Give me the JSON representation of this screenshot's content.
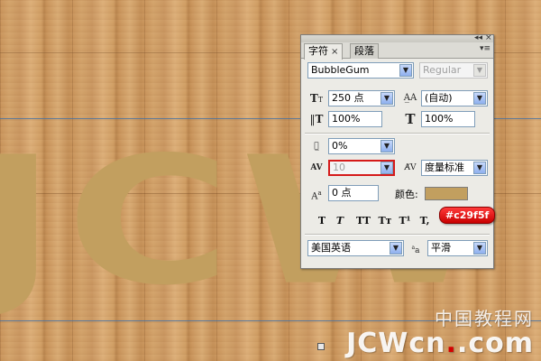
{
  "canvas": {
    "text": "JCW",
    "text_color": "#c29f5f",
    "guide_color": "#3f6fa8"
  },
  "watermark": {
    "cn": "中国教程网",
    "en_prefix": "JCW",
    "en_accent": "c",
    "en_dot": "n",
    "en_suffix": ".com"
  },
  "panel": {
    "tabs": [
      {
        "label": "字符",
        "active": true,
        "close": "×"
      },
      {
        "label": "段落",
        "active": false
      }
    ],
    "font_family": "BubbleGum",
    "font_style": "Regular",
    "font_size": "250 点",
    "leading": "(自动)",
    "vertical_scale": "100%",
    "horizontal_scale": "100%",
    "tsume": "0%",
    "kerning": "10",
    "tracking": "度量标准",
    "baseline_shift": "0 点",
    "color_label": "颜色:",
    "color_value": "#c29f5f",
    "color_hex_label": "#c29f5f",
    "style_buttons": [
      "T",
      "T",
      "TT",
      "Tᴛ",
      "T¹",
      "T,"
    ],
    "language": "美国英语",
    "antialias": "平滑",
    "icons": {
      "size": "font-size-icon",
      "leading": "leading-icon",
      "vertical_scale": "vertical-scale-icon",
      "horizontal_scale": "horizontal-scale-icon",
      "tsume": "tsume-icon",
      "kerning": "kerning-icon",
      "tracking": "tracking-icon",
      "baseline": "baseline-shift-icon",
      "antialias": "antialias-icon"
    }
  }
}
